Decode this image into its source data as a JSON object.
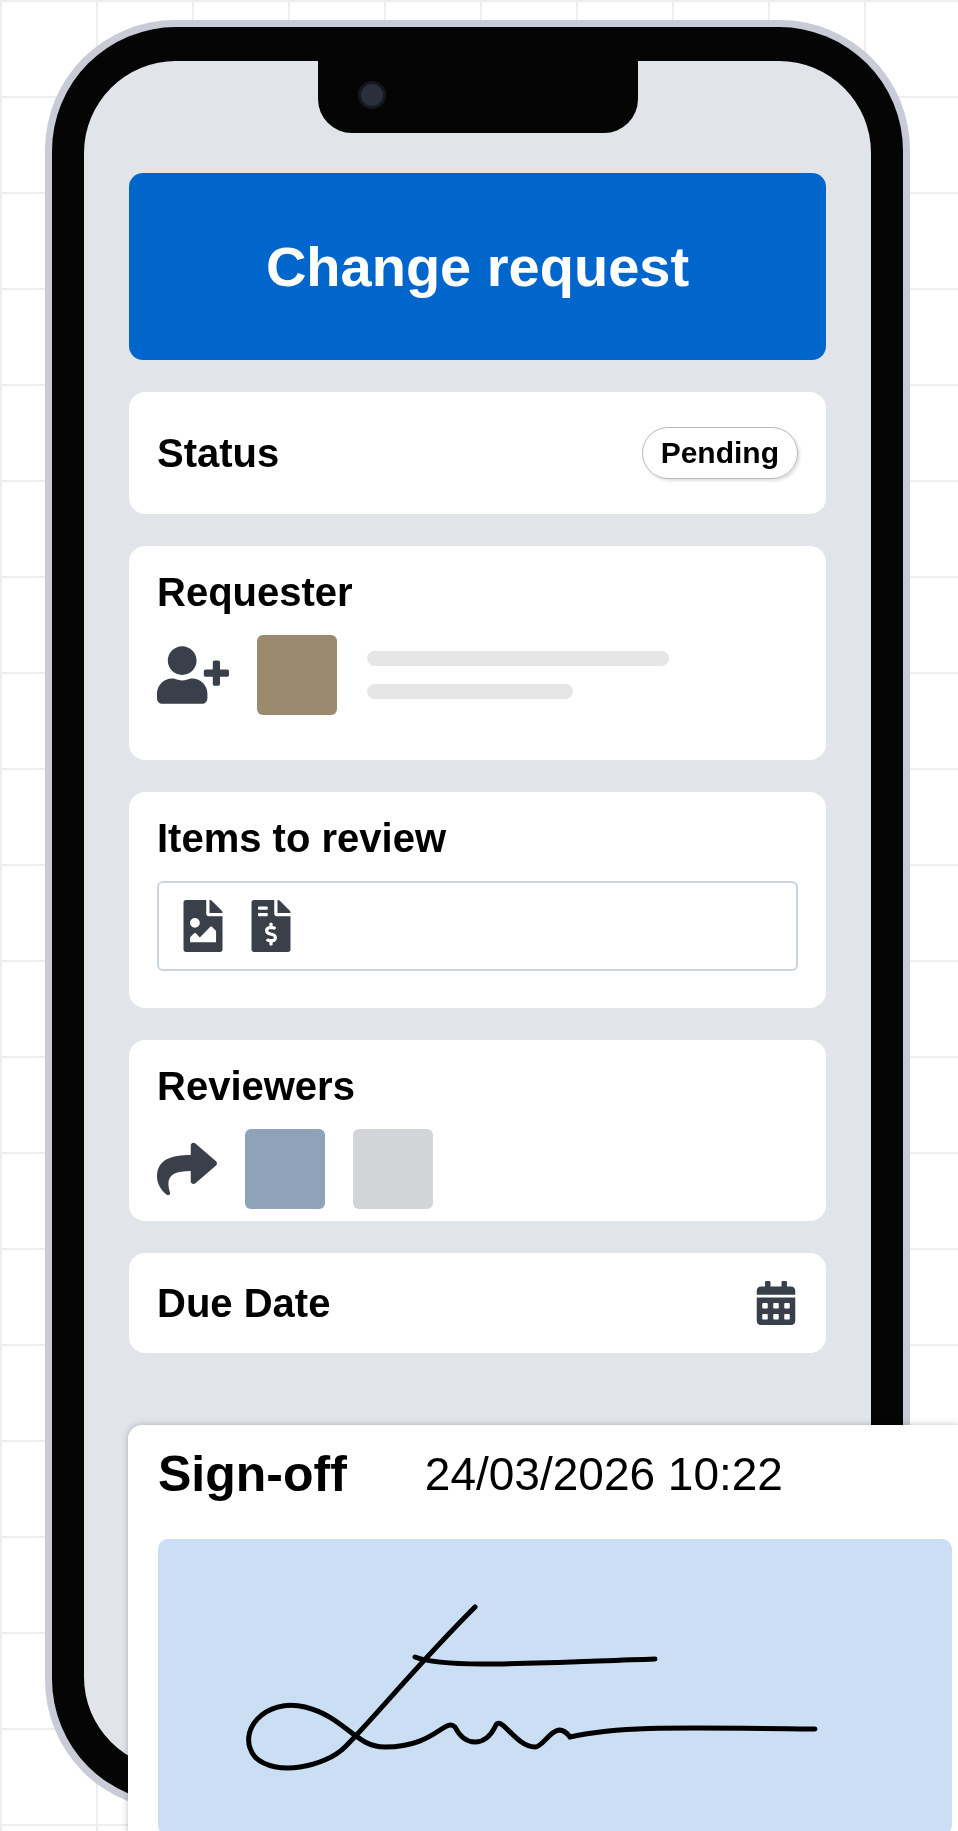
{
  "header": {
    "title": "Change request"
  },
  "status": {
    "label": "Status",
    "badge": "Pending"
  },
  "requester": {
    "label": "Requester"
  },
  "items_to_review": {
    "label": "Items to review"
  },
  "reviewers": {
    "label": "Reviewers"
  },
  "due_date": {
    "label": "Due Date"
  },
  "sign_off": {
    "label": "Sign-off",
    "timestamp": "24/03/2026 10:22"
  }
}
